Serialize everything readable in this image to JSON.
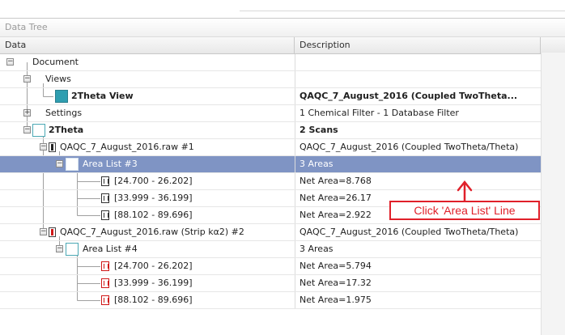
{
  "panel": {
    "title": "Data Tree",
    "columns": {
      "data": "Data",
      "description": "Description"
    }
  },
  "rows": [
    {
      "label": "Document",
      "description": ""
    },
    {
      "label": "Views",
      "description": ""
    },
    {
      "label": "2Theta View",
      "description": "QAQC_7_August_2016 (Coupled TwoTheta..."
    },
    {
      "label": "Settings",
      "description": "1 Chemical Filter - 1 Database Filter"
    },
    {
      "label": "2Theta",
      "description": "2 Scans"
    },
    {
      "label": "QAQC_7_August_2016.raw #1",
      "description": "QAQC_7_August_2016 (Coupled TwoTheta/Theta)"
    },
    {
      "label": "Area List #3",
      "description": "3 Areas"
    },
    {
      "label": "[24.700 - 26.202]",
      "description": "Net Area=8.768"
    },
    {
      "label": "[33.999 - 36.199]",
      "description": "Net Area=26.17"
    },
    {
      "label": "[88.102 - 89.696]",
      "description": "Net Area=2.922"
    },
    {
      "label": "QAQC_7_August_2016.raw (Strip kα2) #2",
      "description": "QAQC_7_August_2016 (Coupled TwoTheta/Theta)"
    },
    {
      "label": "Area List #4",
      "description": "3 Areas"
    },
    {
      "label": "[24.700 - 26.202]",
      "description": "Net Area=5.794"
    },
    {
      "label": "[33.999 - 36.199]",
      "description": "Net Area=17.32"
    },
    {
      "label": "[88.102 - 89.696]",
      "description": "Net Area=1.975"
    }
  ],
  "annotation": {
    "text": "Click 'Area List' Line",
    "color": "#e0202a"
  },
  "colors": {
    "selected_row": "#7f94c4",
    "accent": "#2f9eb0"
  },
  "icons": {
    "expander_minus": "−",
    "expander_plus": "+"
  }
}
